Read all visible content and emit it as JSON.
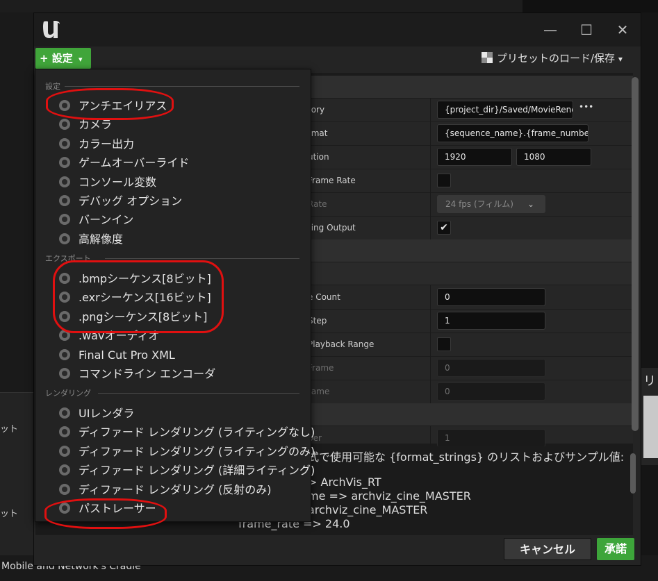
{
  "background": {
    "left_labels": [
      "ット",
      "ット"
    ],
    "bottom_text": "Mobile and Network's Cradle",
    "right_label": "リ"
  },
  "window": {
    "logo": "unreal-engine-logo",
    "minimize_glyph": "—",
    "maximize_glyph": "☐",
    "close_glyph": "✕"
  },
  "toolbar": {
    "add_label": "+ 設定",
    "add_caret": "▾",
    "preset_label": "プリセットのロード/保存",
    "preset_caret": "▾"
  },
  "properties": {
    "rows": [
      {
        "label": "Output Directory",
        "visible_label": "tory",
        "value": "{project_dir}/Saved/MovieRend",
        "extra": "•••"
      },
      {
        "label": "File Name Format",
        "visible_label": "rmat",
        "value": "{sequence_name}.{frame_number}"
      },
      {
        "label": "Output Resolution",
        "visible_label": "ution",
        "value_x": "1920",
        "value_y": "1080"
      },
      {
        "label": "Use Custom Frame Rate",
        "visible_label": "Frame Rate",
        "checked": false
      },
      {
        "label": "Output Frame Rate",
        "visible_label": "Rate",
        "combo": "24 fps (フィルム)",
        "combo_caret": "⌄"
      },
      {
        "label": "Override Existing Output",
        "visible_label": "ting Output",
        "checked": true
      }
    ],
    "rows2": [
      {
        "label": "Handle Frame Count",
        "visible_label": "e Count",
        "value": "0"
      },
      {
        "label": "Output Frame Step",
        "visible_label": "Step",
        "value": "1"
      },
      {
        "label": "Use Custom Playback Range",
        "visible_label": "Playback Range",
        "checked": false
      },
      {
        "label": "Custom Start Frame",
        "visible_label": "Frame",
        "value": "0"
      },
      {
        "label": "Custom End Frame",
        "visible_label": "rame",
        "value": "0"
      }
    ],
    "rows3": [
      {
        "label": "Version Number",
        "visible_label": "ber",
        "value": "1"
      }
    ]
  },
  "description": {
    "lines": [
      "式で使用可能な {format_strings} のリストおよびサンプル値:",
      "",
      "> ArchVis_RT",
      "me => archviz_cine_MASTER",
      "archviz_cine_MASTER",
      "frame_rate => 24.0"
    ]
  },
  "footer": {
    "cancel_label": "キャンセル",
    "accept_label": "承諾"
  },
  "menu": {
    "categories": [
      {
        "title": "設定",
        "items": [
          "アンチエイリアス",
          "カメラ",
          "カラー出力",
          "ゲームオーバーライド",
          "コンソール変数",
          "デバッグ オプション",
          "バーンイン",
          "高解像度"
        ]
      },
      {
        "title": "エクスポート",
        "items": [
          ".bmpシーケンス[8ビット]",
          ".exrシーケンス[16ビット]",
          ".pngシーケンス[8ビット]",
          ".wavオーディオ",
          "Final Cut Pro XML",
          "コマンドライン エンコーダ"
        ]
      },
      {
        "title": "レンダリング",
        "items": [
          "UIレンダラ",
          "ディファード レンダリング (ライティングなし)",
          "ディファード レンダリング (ライティングのみ)",
          "ディファード レンダリング (詳細ライティング)",
          "ディファード レンダリング (反射のみ)",
          "パストレーサー"
        ]
      }
    ],
    "item_icon": "setting-cube-icon"
  },
  "colors": {
    "accent_green": "#40a53a",
    "annotation_red": "#e01010",
    "panel_bg": "#242424"
  }
}
